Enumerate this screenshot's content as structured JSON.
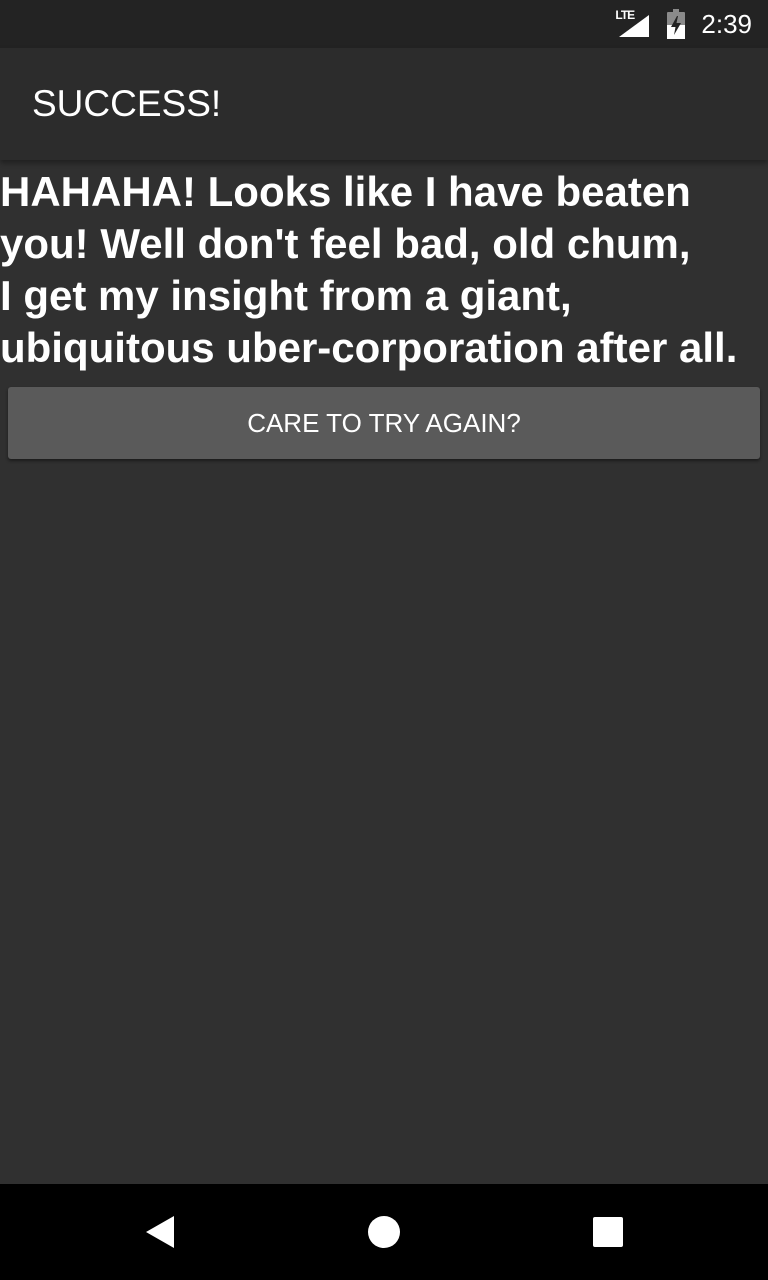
{
  "status_bar": {
    "network_label": "LTE",
    "time": "2:39",
    "icons": [
      "lte-signal-icon",
      "battery-charging-icon"
    ]
  },
  "app_bar": {
    "title": "SUCCESS!"
  },
  "main": {
    "message": "HAHAHA! Looks like I have beaten\nyou! Well don't feel bad, old chum,\nI get my insight from a giant,\nubiquitous uber-corporation after all.",
    "retry_button_label": "CARE TO TRY AGAIN?"
  },
  "nav_bar": {
    "icons": [
      "back-icon",
      "home-icon",
      "recents-icon"
    ]
  },
  "colors": {
    "background": "#303030",
    "app_bar": "#2c2c2c",
    "status_bar": "#232323",
    "button": "#5a5a5a",
    "text": "#ffffff"
  }
}
